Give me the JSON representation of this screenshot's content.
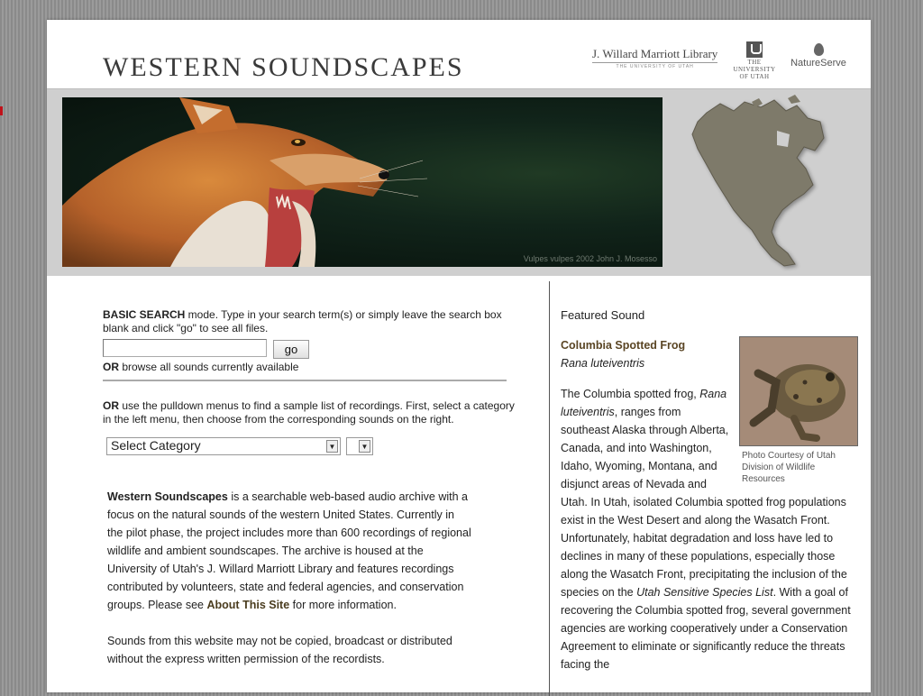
{
  "header": {
    "site_title": "WESTERN SOUNDSCAPES",
    "library_name": "J. Willard Marriott Library",
    "library_sub": "THE UNIVERSITY OF UTAH",
    "university_lines": [
      "THE",
      "UNIVERSITY",
      "OF UTAH"
    ],
    "natureserve": "NatureServe"
  },
  "banner": {
    "photo_credit": "Vulpes vulpes   2002 John J. Mosesso"
  },
  "search": {
    "mode_label": "BASIC SEARCH",
    "mode_text": " mode. Type in your search term(s) or simply leave the search box blank and click \"go\" to see all files.",
    "input_value": "",
    "go_label": "go",
    "or_label": "OR",
    "browse_text": " browse all sounds currently available",
    "menus_text": " use the pulldown menus to find a sample list of recordings. First, select a category in the left menu, then choose from the corresponding sounds on the right.",
    "category_selected": "Select Category",
    "sound_selected": ""
  },
  "about": {
    "lead": "Western Soundscapes",
    "text": " is a searchable web-based audio archive with a focus on the natural sounds of the western United States. Currently in the pilot phase, the project includes more than 600 recordings of regional wildlife and ambient soundscapes. The archive is housed at the University of Utah's J. Willard Marriott Library and features recordings contributed by volunteers, state and federal agencies, and conservation groups. Please see ",
    "link": "About This Site",
    "tail": " for more information.",
    "rights": "Sounds from this website may not be copied, broadcast or distributed without the express written permission of the recordists."
  },
  "featured": {
    "label": "Featured Sound",
    "common_name": "Columbia Spotted Frog",
    "latin_name": "Rana luteiventris",
    "caption": "Photo Courtesy of Utah Division of Wildlife Resources",
    "desc_1": "The Columbia spotted frog, ",
    "desc_latin": "Rana luteiventris",
    "desc_2": ", ranges from southeast Alaska through Alberta, Canada, and into Washington, Idaho, Wyoming, Montana, and disjunct areas of Nevada and Utah. In Utah, isolated Columbia spotted frog populations exist in the West Desert and along the Wasatch Front. Unfortunately, habitat degradation and loss have led to declines in many of these populations, especially those along the Wasatch Front, precipitating the inclusion of the species on the ",
    "desc_list": "Utah Sensitive Species List",
    "desc_3": ". With a goal of recovering the Columbia spotted frog, several government agencies are working cooperatively under a Conservation Agreement to eliminate or significantly reduce the threats facing the"
  },
  "colors": {
    "link_brown": "#5a4524",
    "background_stripe": "#8a8a8a",
    "banner_gray": "#cfcfcf"
  }
}
